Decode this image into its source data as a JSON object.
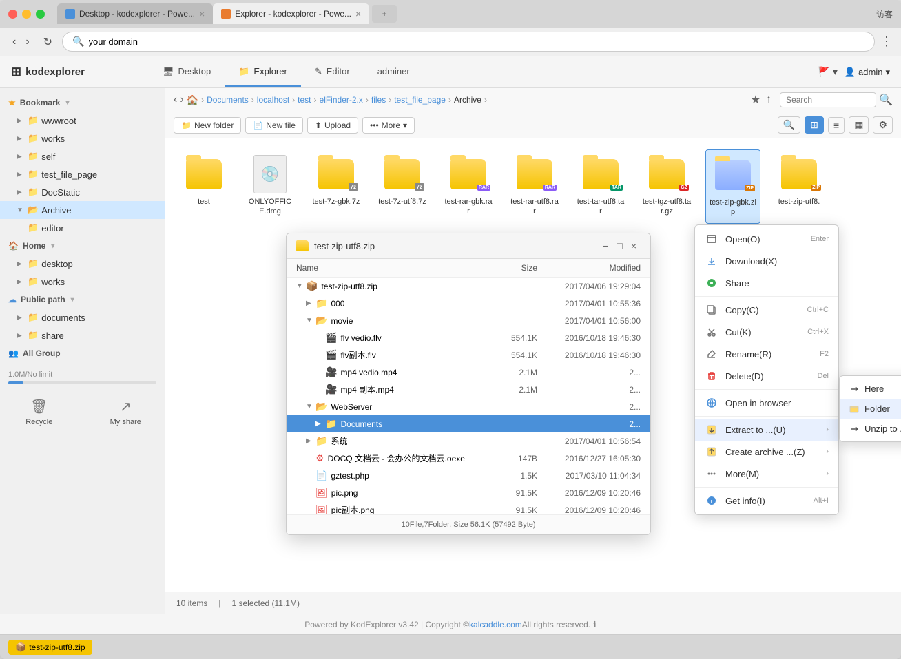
{
  "browser": {
    "visitor_label": "访客",
    "address": "your domain",
    "tabs": [
      {
        "label": "Desktop - kodexplorer - Powe...",
        "active": false
      },
      {
        "label": "Explorer - kodexplorer - Powe...",
        "active": true
      }
    ]
  },
  "app": {
    "logo": "kodexplorer",
    "logo_symbol": "⊞",
    "header_tabs": [
      {
        "label": "Desktop",
        "icon": "🖥",
        "active": false
      },
      {
        "label": "Explorer",
        "icon": "📁",
        "active": true
      },
      {
        "label": "Editor",
        "icon": "✎",
        "active": false
      },
      {
        "label": "adminer",
        "active": false
      }
    ],
    "admin_label": "admin"
  },
  "sidebar": {
    "bookmark_label": "Bookmark",
    "bookmark_items": [
      {
        "label": "wwwroot",
        "indent": 1
      },
      {
        "label": "works",
        "indent": 1
      },
      {
        "label": "self",
        "indent": 1
      },
      {
        "label": "test_file_page",
        "indent": 1
      },
      {
        "label": "DocStatic",
        "indent": 1
      },
      {
        "label": "Archive",
        "indent": 1,
        "active": true
      }
    ],
    "editor_item": "editor",
    "home_label": "Home",
    "home_items": [
      {
        "label": "desktop",
        "indent": 1
      },
      {
        "label": "works",
        "indent": 1
      }
    ],
    "public_path_label": "Public path",
    "public_items": [
      {
        "label": "documents",
        "indent": 1
      },
      {
        "label": "share",
        "indent": 1
      }
    ],
    "all_group_label": "All Group",
    "storage_label": "1.0M/No limit",
    "recycle_label": "Recycle",
    "my_share_label": "My share"
  },
  "breadcrumb": {
    "items": [
      "Documents",
      "localhost",
      "test",
      "elFinder-2.x",
      "files",
      "test_file_page",
      "Archive"
    ]
  },
  "toolbar": {
    "new_folder_label": "New folder",
    "new_file_label": "New file",
    "upload_label": "Upload",
    "more_label": "More"
  },
  "files": [
    {
      "name": "test",
      "type": "folder"
    },
    {
      "name": "ONLYOFFICE.dmg",
      "type": "dmg"
    },
    {
      "name": "test-7z-gbk.7z",
      "type": "7z"
    },
    {
      "name": "test-7z-utf8.7z",
      "type": "7z"
    },
    {
      "name": "test-rar-gbk.rar",
      "type": "rar"
    },
    {
      "name": "test-rar-utf8.rar",
      "type": "rar"
    },
    {
      "name": "test-tar-utf8.tar",
      "type": "tar"
    },
    {
      "name": "test-tgz-utf8.tar.gz",
      "type": "tgz"
    },
    {
      "name": "test-zip-gbk.zip",
      "type": "zip",
      "selected": true
    },
    {
      "name": "test-zip-utf8.",
      "type": "zip"
    }
  ],
  "status_bar": {
    "items_count": "10 items",
    "selected": "1 selected (11.1M)"
  },
  "zip_dialog": {
    "title": "test-zip-utf8.zip",
    "columns": {
      "name": "Name",
      "size": "Size",
      "modified": "Modified"
    },
    "rows": [
      {
        "name": "test-zip-utf8.zip",
        "indent": 0,
        "expanded": true,
        "type": "zip",
        "modified": "2017/04/06 19:29:04"
      },
      {
        "name": "000",
        "indent": 1,
        "type": "folder",
        "modified": "2017/04/01 10:55:36",
        "expanded": false
      },
      {
        "name": "movie",
        "indent": 1,
        "type": "folder",
        "expanded": true,
        "modified": "2017/04/01 10:56:00"
      },
      {
        "name": "flv vedio.flv",
        "indent": 2,
        "type": "flv",
        "size": "554.1K",
        "modified": "2016/10/18 19:46:30"
      },
      {
        "name": "flv副本.flv",
        "indent": 2,
        "type": "flv",
        "size": "554.1K",
        "modified": "2016/10/18 19:46:30"
      },
      {
        "name": "mp4 vedio.mp4",
        "indent": 2,
        "type": "mp4",
        "size": "2.1M",
        "modified": "2..."
      },
      {
        "name": "mp4 副本.mp4",
        "indent": 2,
        "type": "mp4",
        "size": "2.1M",
        "modified": "2..."
      },
      {
        "name": "WebServer",
        "indent": 1,
        "type": "folder",
        "expanded": false,
        "modified": "2..."
      },
      {
        "name": "Documents",
        "indent": 2,
        "type": "folder",
        "selected": true,
        "modified": "2..."
      },
      {
        "name": "系统",
        "indent": 1,
        "type": "folder",
        "modified": "2017/04/01 10:56:54"
      },
      {
        "name": "DOCQ 文档云 - 会办公的文档云.oexe",
        "indent": 1,
        "type": "exe",
        "size": "147B",
        "modified": "2016/12/27 16:05:30"
      },
      {
        "name": "gztest.php",
        "indent": 1,
        "type": "php",
        "size": "1.5K",
        "modified": "2017/03/10 11:04:34"
      },
      {
        "name": "pic.png",
        "indent": 1,
        "type": "png",
        "size": "91.5K",
        "modified": "2016/12/09 10:20:46"
      },
      {
        "name": "pic副本.png",
        "indent": 1,
        "type": "png",
        "size": "91.5K",
        "modified": "2016/12/09 10:20:46"
      }
    ],
    "footer": "10File,7Folder, Size 56.1K (57492 Byte)"
  },
  "context_menu": {
    "items": [
      {
        "label": "Open(O)",
        "shortcut": "Enter",
        "icon": "open"
      },
      {
        "label": "Download(X)",
        "icon": "download"
      },
      {
        "label": "Share",
        "icon": "share"
      },
      {
        "separator": true
      },
      {
        "label": "Copy(C)",
        "shortcut": "Ctrl+C",
        "icon": "copy"
      },
      {
        "label": "Cut(K)",
        "shortcut": "Ctrl+X",
        "icon": "cut"
      },
      {
        "label": "Rename(R)",
        "shortcut": "F2",
        "icon": "rename"
      },
      {
        "label": "Delete(D)",
        "shortcut": "Del",
        "icon": "delete"
      },
      {
        "separator": true
      },
      {
        "label": "Open in browser",
        "icon": "browser"
      },
      {
        "separator": true
      },
      {
        "label": "Extract to ...(U)",
        "icon": "extract",
        "has_sub": true
      },
      {
        "label": "Create archive ...(Z)",
        "icon": "archive",
        "has_sub": true
      },
      {
        "label": "More(M)",
        "icon": "more",
        "has_sub": true
      },
      {
        "separator": true
      },
      {
        "label": "Get info(I)",
        "shortcut": "Alt+I",
        "icon": "info"
      }
    ]
  },
  "extract_submenu": {
    "items": [
      {
        "label": "Here"
      },
      {
        "label": "Folder",
        "active": true
      },
      {
        "label": "Unzip to ..."
      }
    ]
  },
  "footer": {
    "text": "Powered by KodExplorer v3.42 | Copyright © ",
    "link_text": "kalcaddle.com",
    "suffix": " All rights reserved."
  }
}
